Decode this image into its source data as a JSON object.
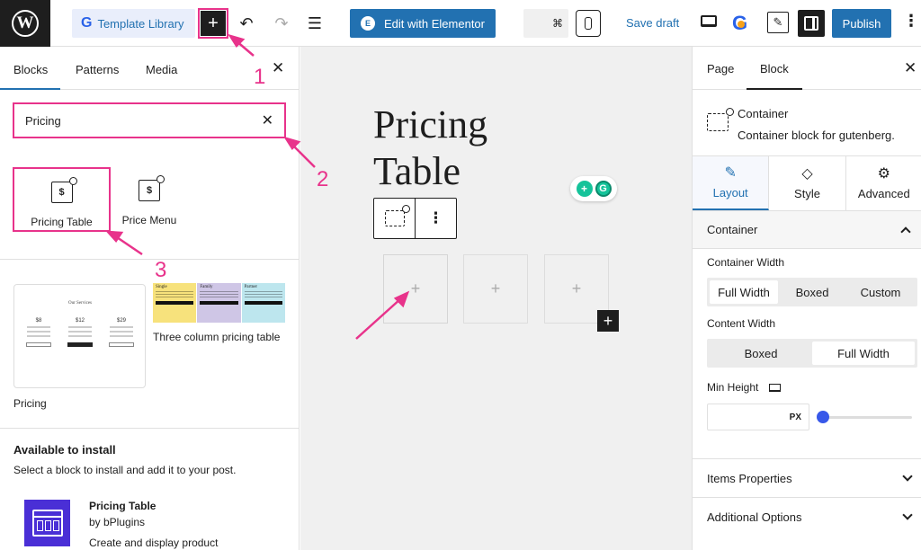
{
  "topbar": {
    "template_library": "Template Library",
    "edit_with_elementor": "Edit with Elementor",
    "shortcut": "⌘",
    "save_draft": "Save draft",
    "publish": "Publish"
  },
  "left_panel": {
    "tabs": [
      "Blocks",
      "Patterns",
      "Media"
    ],
    "search_value": "Pricing",
    "results": [
      {
        "label": "Pricing Table",
        "icon": "pricing-table-icon"
      },
      {
        "label": "Price Menu",
        "icon": "price-menu-icon"
      }
    ],
    "patterns": [
      {
        "label": "Pricing",
        "preview_title": "Our Services",
        "prices": [
          "$8",
          "$12",
          "$29"
        ]
      },
      {
        "label": "Three column pricing table",
        "columns": [
          "Single",
          "Family",
          "Partner"
        ]
      }
    ],
    "available": {
      "heading": "Available to install",
      "subtitle": "Select a block to install and add it to your post.",
      "plugin_title": "Pricing Table",
      "plugin_by": "by bPlugins",
      "plugin_desc": "Create and display product"
    }
  },
  "canvas": {
    "title_line1": "Pricing",
    "title_line2": "Table",
    "column_placeholder": "+",
    "inserter": "+"
  },
  "right_panel": {
    "tabs": [
      "Page",
      "Block"
    ],
    "block_title": "Container",
    "block_desc": "Container block for gutenberg.",
    "settings_tabs": [
      "Layout",
      "Style",
      "Advanced"
    ],
    "section": "Container",
    "container_width_label": "Container Width",
    "container_width_options": [
      "Full Width",
      "Boxed",
      "Custom"
    ],
    "container_width_selected": "Full Width",
    "content_width_label": "Content Width",
    "content_width_options": [
      "Boxed",
      "Full Width"
    ],
    "content_width_selected": "Full Width",
    "min_height_label": "Min Height",
    "min_height_unit": "PX",
    "min_height_slider_fraction": 0,
    "items_properties": "Items Properties",
    "additional_options": "Additional Options"
  },
  "annotations": [
    "1",
    "2",
    "3"
  ],
  "colors": {
    "accent": "#2271b1",
    "annotation": "#e8338b",
    "slider": "#3858e9"
  }
}
